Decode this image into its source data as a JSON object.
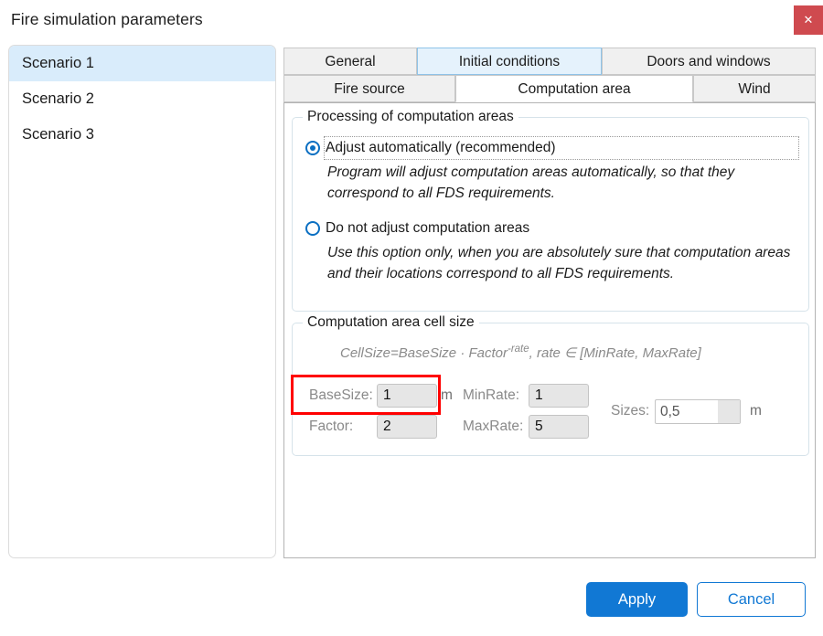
{
  "window": {
    "title": "Fire simulation parameters",
    "close_label": "✕",
    "close_color": "#cf4a4f"
  },
  "scenarios": {
    "items": [
      {
        "label": "Scenario 1",
        "selected": true
      },
      {
        "label": "Scenario 2",
        "selected": false
      },
      {
        "label": "Scenario 3",
        "selected": false
      }
    ],
    "selected_highlight": "#d9ecfb"
  },
  "tabs": {
    "row1": [
      {
        "label": "General",
        "state": "normal"
      },
      {
        "label": "Initial conditions",
        "state": "hover"
      },
      {
        "label": "Doors and windows",
        "state": "normal"
      }
    ],
    "row2": [
      {
        "label": "Fire source",
        "state": "normal"
      },
      {
        "label": "Computation area",
        "state": "selected"
      },
      {
        "label": "Wind",
        "state": "normal"
      }
    ]
  },
  "processing_group": {
    "title": "Processing of computation areas",
    "options": [
      {
        "label": "Adjust automatically (recommended)",
        "selected": true,
        "focused": true,
        "description": "Program will adjust computation areas automatically, so that they correspond to all FDS requirements."
      },
      {
        "label": "Do not adjust computation areas",
        "selected": false,
        "focused": false,
        "description": "Use this option only, when you are absolutely sure that computation areas and their locations correspond to all FDS requirements."
      }
    ],
    "accent_color": "#0a6fc2"
  },
  "cellsize_group": {
    "title": "Computation area cell size",
    "formula_main": "CellSize=BaseSize · Factor",
    "formula_exponent": "-rate",
    "formula_tail": ", rate ∈ [MinRate, MaxRate]",
    "fields": {
      "basesize": {
        "label": "BaseSize:",
        "value": "1",
        "unit": "m",
        "enabled": false
      },
      "factor": {
        "label": "Factor:",
        "value": "2",
        "unit": "",
        "enabled": false
      },
      "minrate": {
        "label": "MinRate:",
        "value": "1",
        "unit": "",
        "enabled": false
      },
      "maxrate": {
        "label": "MaxRate:",
        "value": "5",
        "unit": "",
        "enabled": false
      },
      "sizes": {
        "label": "Sizes:",
        "value": "0,5",
        "unit": "m",
        "enabled": true
      }
    }
  },
  "annotation": {
    "color": "#ff0000",
    "target": "BaseSize field"
  },
  "footer": {
    "apply_label": "Apply",
    "cancel_label": "Cancel",
    "accent_color": "#1178d4"
  }
}
